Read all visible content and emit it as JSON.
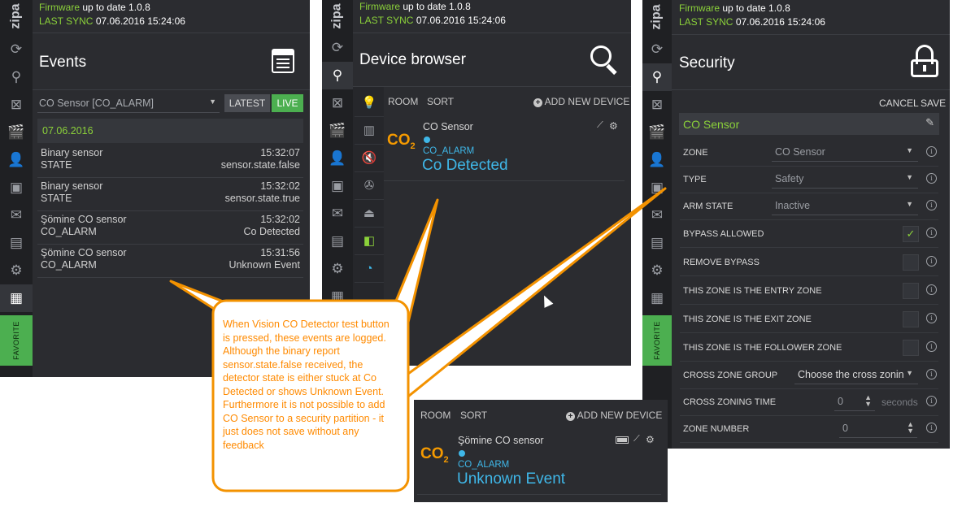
{
  "common": {
    "brand": "zipa",
    "firmware_label": "Firmware",
    "firmware_status": "up to date 1.0.8",
    "last_sync_label": "LAST SYNC",
    "last_sync_value": "07.06.2016 15:24:06",
    "favorite_label": "FAVORITE"
  },
  "events": {
    "title": "Events",
    "filter_value": "CO Sensor [CO_ALARM]",
    "latest_button": "LATEST",
    "live_button": "LIVE",
    "date": "07.06.2016",
    "items": [
      {
        "name": "Binary sensor",
        "type": "STATE",
        "time": "15:32:07",
        "value": "sensor.state.false"
      },
      {
        "name": "Binary sensor",
        "type": "STATE",
        "time": "15:32:02",
        "value": "sensor.state.true"
      },
      {
        "name": "Şömine CO sensor",
        "type": "CO_ALARM",
        "time": "15:32:02",
        "value": "Co Detected"
      },
      {
        "name": "Şömine CO sensor",
        "type": "CO_ALARM",
        "time": "15:31:56",
        "value": "Unknown Event"
      }
    ]
  },
  "device_browser": {
    "title": "Device browser",
    "room_label": "ROOM",
    "sort_label": "SORT",
    "add_device_label": "ADD NEW DEVICE",
    "co2_label": "CO",
    "co2_sub": "2",
    "device": {
      "name": "CO Sensor",
      "alarm": "CO_ALARM",
      "status": "Co Detected"
    }
  },
  "device_popup": {
    "room_label": "ROOM",
    "sort_label": "SORT",
    "add_device_label": "ADD NEW DEVICE",
    "co2_label": "CO",
    "co2_sub": "2",
    "device": {
      "name": "Şömine CO sensor",
      "alarm": "CO_ALARM",
      "status": "Unknown Event"
    }
  },
  "security": {
    "title": "Security",
    "cancel_button": "CANCEL",
    "save_button": "SAVE",
    "sensor_name": "CO Sensor",
    "rows": {
      "zone_label": "ZONE",
      "zone_value": "CO Sensor",
      "type_label": "TYPE",
      "type_value": "Safety",
      "arm_label": "ARM STATE",
      "arm_value": "Inactive",
      "bypass_allowed_label": "BYPASS ALLOWED",
      "remove_bypass_label": "REMOVE BYPASS",
      "entry_zone_label": "THIS ZONE IS THE ENTRY ZONE",
      "exit_zone_label": "THIS ZONE IS THE EXIT ZONE",
      "follower_zone_label": "THIS ZONE IS THE FOLLOWER ZONE",
      "cross_group_label": "CROSS ZONE GROUP",
      "cross_group_value": "Choose the cross zonin",
      "cross_time_label": "CROSS ZONING TIME",
      "cross_time_value": "0",
      "cross_time_unit": "seconds",
      "zone_number_label": "ZONE NUMBER",
      "zone_number_value": "0"
    }
  },
  "callout": {
    "text": "When Vision CO Detector test button is pressed, these events are logged. Although the binary report sensor.state.false received, the detector state is either stuck at Co Detected or shows Unknown Event. Furthermore it is not possible to add CO Sensor to a security partition - it just does not save without any feedback"
  },
  "colors": {
    "panel_bg": "#2b2c30",
    "rail_bg": "#1f2023",
    "accent_green": "#8bd13a",
    "accent_blue": "#3fb7e8",
    "co2_orange": "#f59a00",
    "callout_orange": "#ff8a00"
  }
}
